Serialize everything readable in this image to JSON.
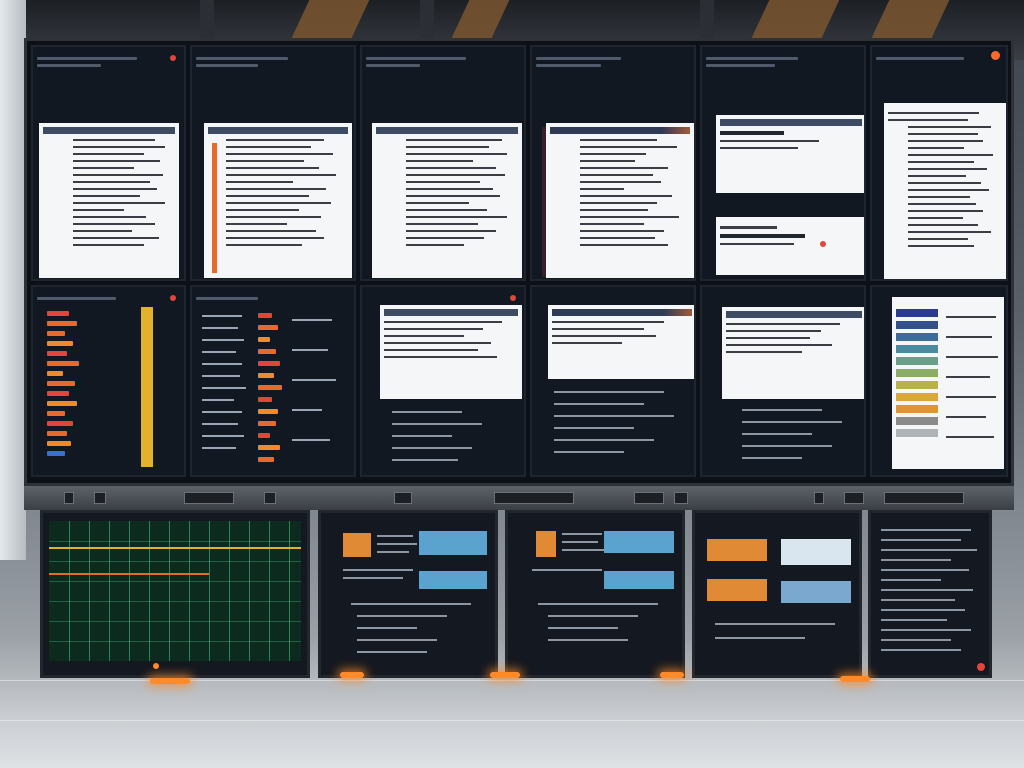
{
  "scene": {
    "description_kind": "control-room monitor wall",
    "palette": {
      "wall_bg": "#0d1117",
      "tile_bg": "#121821",
      "doc_bg": "#f4f6f8",
      "accent_orange": "#e86a2a",
      "accent_yellow": "#e2b22c",
      "accent_blue": "#5aa3cf",
      "status_red": "#e0473a",
      "grid_green": "#50c88c"
    }
  },
  "wall": {
    "rows": 2,
    "columns": 6,
    "tiles": [
      {
        "id": "r1c1",
        "kind": "document-with-sidebar"
      },
      {
        "id": "r1c2",
        "kind": "document-with-orange-highlights"
      },
      {
        "id": "r1c3",
        "kind": "document"
      },
      {
        "id": "r1c4",
        "kind": "document"
      },
      {
        "id": "r1c5",
        "kind": "two-cards"
      },
      {
        "id": "r1c6",
        "kind": "document-tall"
      },
      {
        "id": "r2c1",
        "kind": "horizontal-bar-panel"
      },
      {
        "id": "r2c2",
        "kind": "horizontal-bar-panel"
      },
      {
        "id": "r2c3",
        "kind": "dialog-and-list"
      },
      {
        "id": "r2c4",
        "kind": "dialog-and-list"
      },
      {
        "id": "r2c5",
        "kind": "dialog-and-list"
      },
      {
        "id": "r2c6",
        "kind": "color-legend-panel"
      }
    ]
  },
  "consoles": [
    {
      "id": "console-1",
      "kind": "green-data-grid"
    },
    {
      "id": "console-2",
      "kind": "status-summary"
    },
    {
      "id": "console-3",
      "kind": "status-summary"
    },
    {
      "id": "console-4",
      "kind": "status-summary"
    },
    {
      "id": "console-5",
      "kind": "log-text"
    }
  ]
}
